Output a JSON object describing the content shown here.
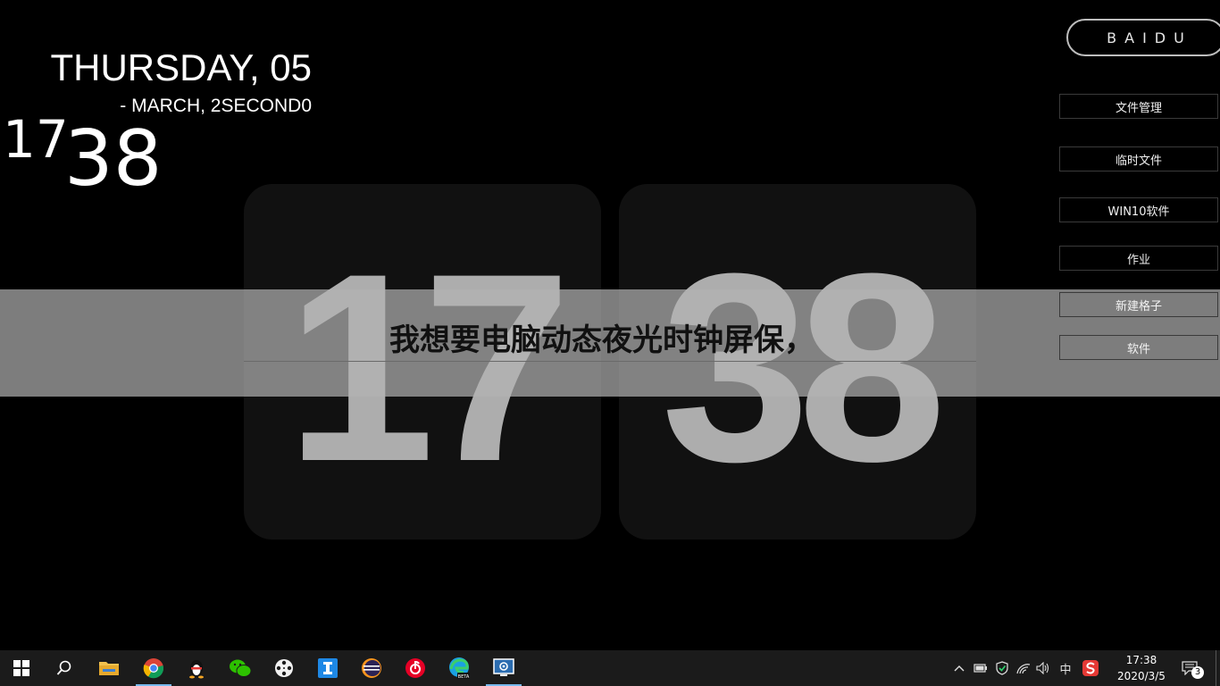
{
  "clock_header": {
    "day_line": "THURSDAY, 05",
    "date_line": "- MARCH, 2SECOND0",
    "small_hour": "17",
    "small_minute": "38"
  },
  "flip_clock": {
    "hours": "17",
    "minutes": "38"
  },
  "banner": {
    "text": "我想要电脑动态夜光时钟屏保，"
  },
  "sidebar": {
    "baidu_label": "BAIDU",
    "shortcuts": [
      {
        "label": "文件管理"
      },
      {
        "label": "临时文件"
      },
      {
        "label": "WIN10软件"
      },
      {
        "label": "作业"
      },
      {
        "label": "新建格子"
      },
      {
        "label": "软件"
      }
    ]
  },
  "taskbar": {
    "apps": [
      {
        "name": "start",
        "icon": "windows-logo-icon"
      },
      {
        "name": "search",
        "icon": "search-icon"
      },
      {
        "name": "file-explorer",
        "icon": "folder-icon"
      },
      {
        "name": "chrome",
        "icon": "chrome-icon"
      },
      {
        "name": "qq",
        "icon": "qq-penguin-icon"
      },
      {
        "name": "wechat",
        "icon": "wechat-icon"
      },
      {
        "name": "media",
        "icon": "film-reel-icon"
      },
      {
        "name": "text-app",
        "icon": "letter-i-icon"
      },
      {
        "name": "eclipse",
        "icon": "eclipse-icon"
      },
      {
        "name": "netease-music",
        "icon": "music-icon"
      },
      {
        "name": "edge-beta",
        "icon": "edge-beta-icon"
      },
      {
        "name": "screensaver-app",
        "icon": "monitor-gear-icon"
      }
    ],
    "tray": {
      "ime_label": "中",
      "time": "17:38",
      "date": "2020/3/5",
      "notification_count": "3"
    }
  },
  "colors": {
    "background": "#000000",
    "card": "#111111",
    "digit": "#adadad",
    "banner": "#b2b2b2",
    "taskbar": "#1b1b1b",
    "accent": "#76b9ed"
  }
}
